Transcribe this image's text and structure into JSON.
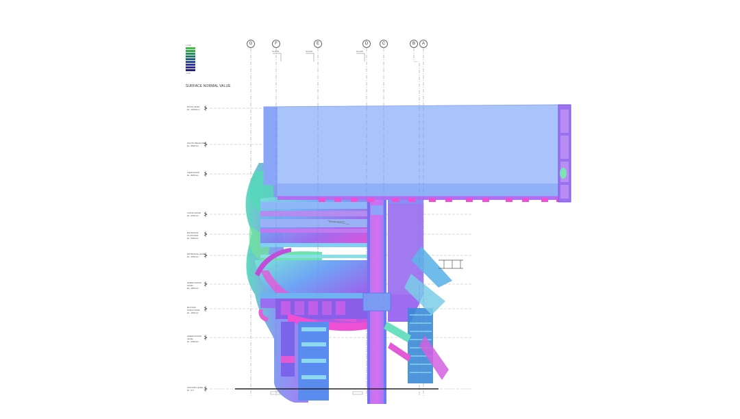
{
  "legend": {
    "title": "SURFACE NORMAL VALUE",
    "top_label": "+1.00",
    "bottom_label": "-1.00",
    "swatches": [
      "#3fbf3f",
      "#2fa84a",
      "#23935a",
      "#1f7d6a",
      "#235f82",
      "#274a98",
      "#2b3aa8",
      "#2a2a9a",
      "#22207f"
    ]
  },
  "grid_lines": [
    "G",
    "F",
    "E",
    "D",
    "C",
    "B",
    "A"
  ],
  "levels": [
    {
      "name": "ROOF LEVEL",
      "elev": "EL. 12000mm"
    },
    {
      "name": "PHOTO BEHOLDER",
      "elev": "EL. 9900mm"
    },
    {
      "name": "VIEW ROOM",
      "elev": "EL. 8200mm"
    },
    {
      "name": "LIVING ROOM",
      "elev": "EL. 6150mm"
    },
    {
      "name": "ENTRANCE PLATFORM",
      "elev": "EL. 5400mm"
    },
    {
      "name": "ENTRANCE LEVEL",
      "elev": "EL. 4300mm"
    },
    {
      "name": "GREEN ROOM LEVEL",
      "elev": "EL. 2800mm"
    },
    {
      "name": "BOTTOM STRUCTURE",
      "elev": "EL. 1500mm"
    },
    {
      "name": "GREEN ROOM LEVEL",
      "elev": "EL. 0000mm"
    },
    {
      "name": "GROUND LEVEL",
      "elev": "EL. 0.0"
    }
  ],
  "annotations": {
    "glass_1": "GLASS",
    "glass_2": "GLASS",
    "glass_3": "GLASS",
    "detail": "DETAIL FIXINGS"
  },
  "colors": {
    "box": "#a9c4fa",
    "box_edge": "#8fa9f0",
    "magenta": "#e04ad8",
    "violet": "#8b56e8",
    "cyan": "#6ee3e0",
    "green": "#7be37a",
    "blue": "#6c8cf5"
  }
}
